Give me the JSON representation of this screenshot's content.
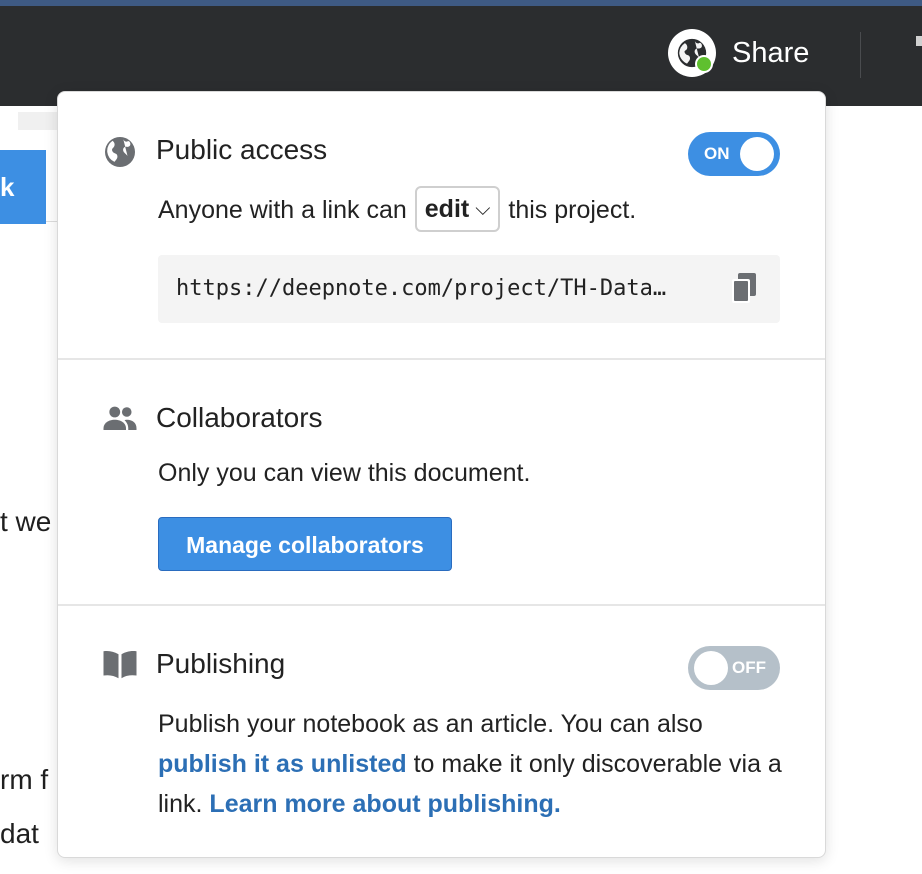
{
  "header": {
    "share_label": "Share"
  },
  "background": {
    "button_fragment": "k",
    "text_lines": [
      "t we",
      "rm f",
      "dat"
    ]
  },
  "share_popover": {
    "public_access": {
      "title": "Public access",
      "toggle_label": "ON",
      "toggle_state": true,
      "sentence_before": "Anyone with a link can",
      "permission_value": "edit",
      "sentence_after": "this project.",
      "link_url": "https://deepnote.com/project/TH-Data…"
    },
    "collaborators": {
      "title": "Collaborators",
      "description": "Only you can view this document.",
      "manage_button": "Manage collaborators"
    },
    "publishing": {
      "title": "Publishing",
      "toggle_label": "OFF",
      "toggle_state": false,
      "text_before": "Publish your notebook as an article. You can also",
      "unlisted_link": "publish it as unlisted",
      "text_middle": "to make it only discoverable via a link.",
      "learn_more_link": "Learn more about publishing."
    }
  },
  "icons": {
    "share": "globe-badge-icon",
    "public_access": "globe-icon",
    "collaborators": "people-icon",
    "publishing": "book-icon",
    "copy": "copy-icon",
    "dropdown": "chevron-down-icon"
  },
  "colors": {
    "accent": "#3d8fe3",
    "link": "#2c6fb5",
    "topbar": "#2b2d2f",
    "online_dot": "#5fc02f",
    "toggle_off": "#b5c0c9"
  }
}
